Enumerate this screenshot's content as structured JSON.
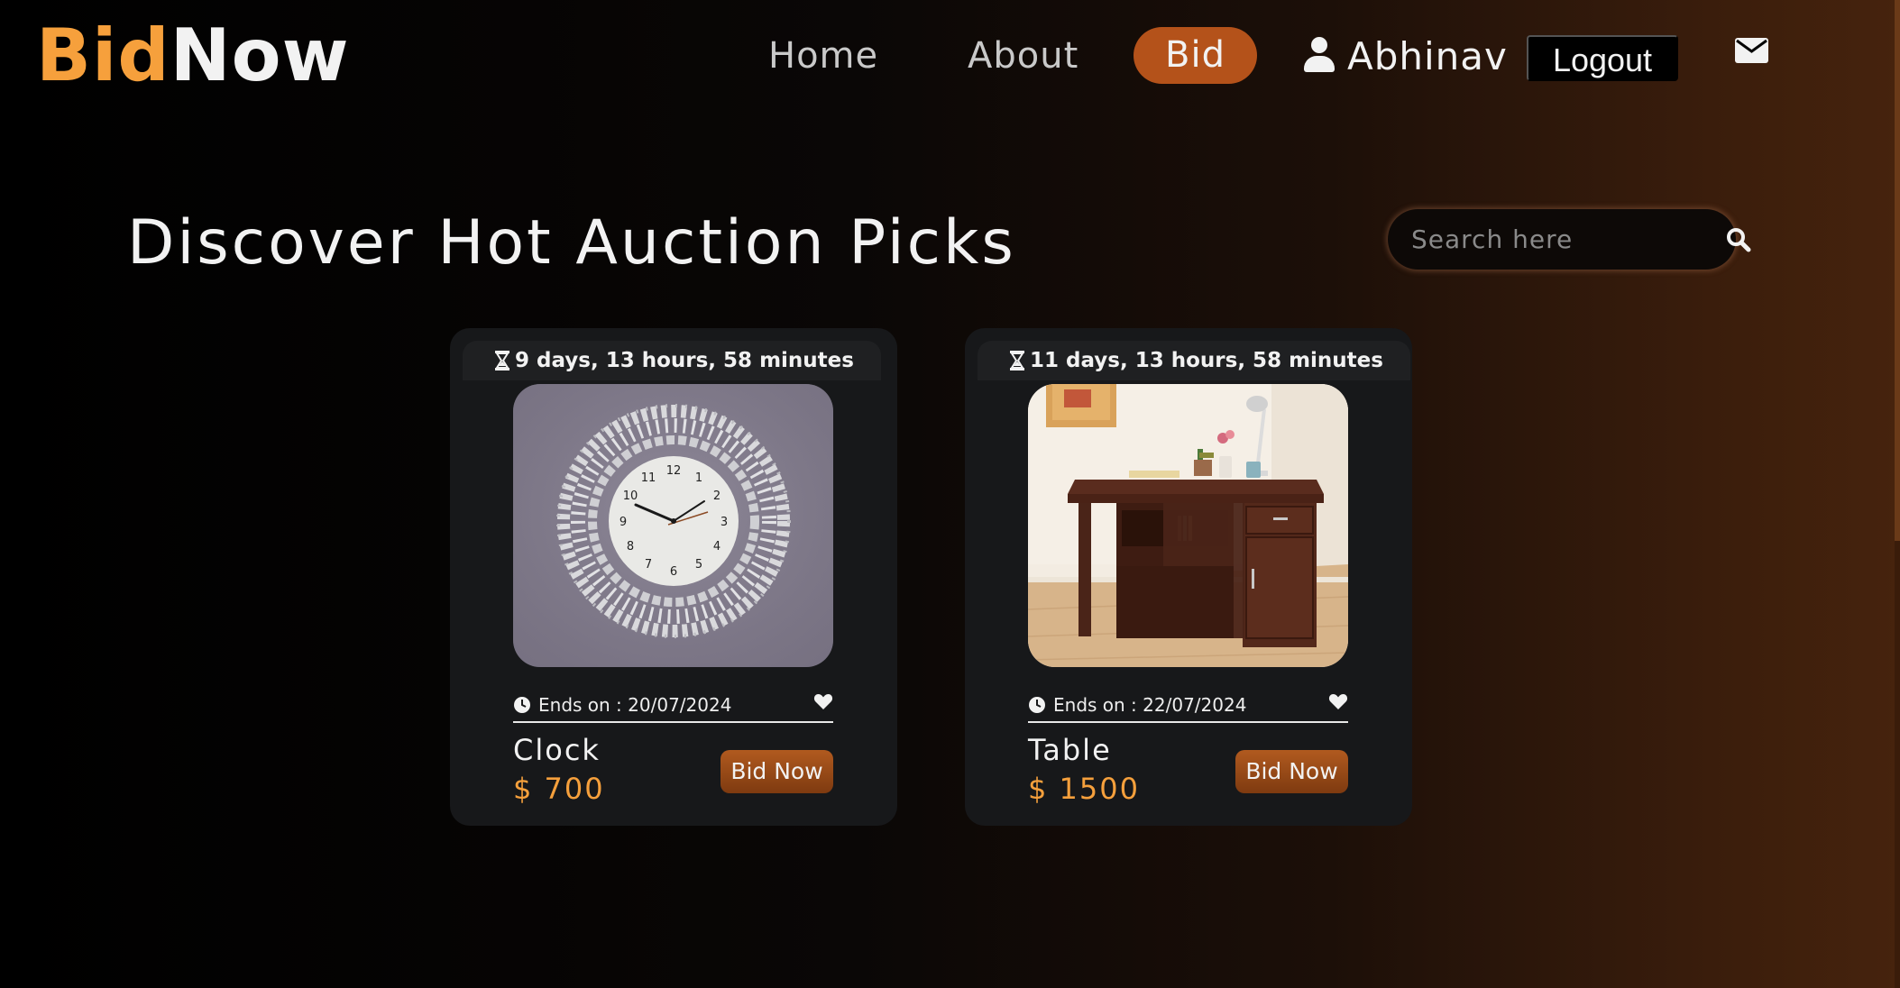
{
  "brand": {
    "part1": "Bid",
    "part2": "Now",
    "accent": "#f6a03c"
  },
  "nav": {
    "home": "Home",
    "about": "About",
    "bid": "Bid",
    "user_name": "Abhinav",
    "logout": "Logout",
    "icons": {
      "user": "user-icon",
      "mail": "envelope-icon"
    }
  },
  "main": {
    "title": "Discover Hot Auction Picks",
    "search": {
      "placeholder": "Search here",
      "value": ""
    }
  },
  "cards": [
    {
      "time_left": "9 days, 13 hours, 58 minutes",
      "ends_on": "Ends on : 20/07/2024",
      "name": "Clock",
      "price": "$ 700",
      "bid_label": "Bid Now",
      "image": "islamic-calligraphy-wall-clock"
    },
    {
      "time_left": "11 days, 13 hours, 58 minutes",
      "ends_on": "Ends on : 22/07/2024",
      "name": "Table",
      "price": "$ 1500",
      "bid_label": "Bid Now",
      "image": "wooden-study-desk"
    }
  ],
  "colors": {
    "accent": "#f6a03c",
    "bid_pill": "#b4521a",
    "card_bg": "#17181a"
  }
}
